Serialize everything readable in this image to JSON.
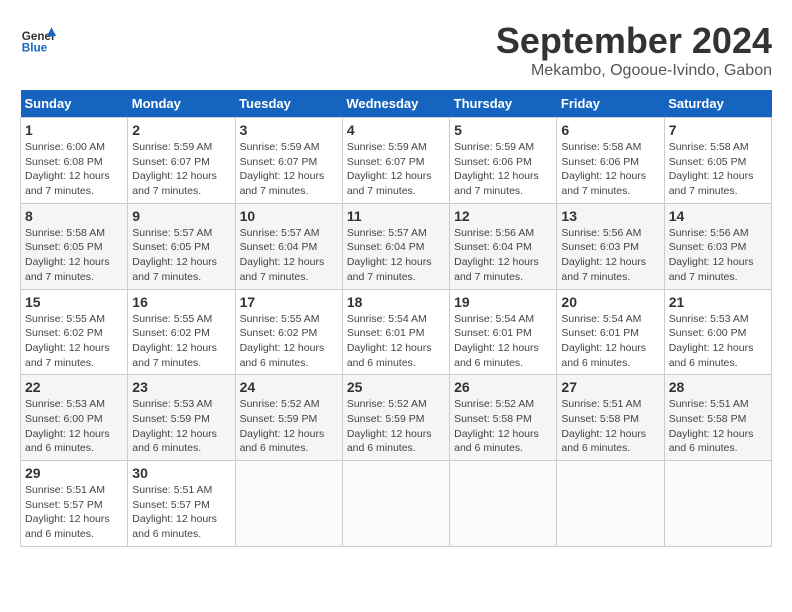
{
  "header": {
    "logo_line1": "General",
    "logo_line2": "Blue",
    "month": "September 2024",
    "location": "Mekambo, Ogooue-Ivindo, Gabon"
  },
  "weekdays": [
    "Sunday",
    "Monday",
    "Tuesday",
    "Wednesday",
    "Thursday",
    "Friday",
    "Saturday"
  ],
  "weeks": [
    [
      {
        "day": 1,
        "sunrise": "6:00 AM",
        "sunset": "6:08 PM",
        "daylight": "12 hours and 7 minutes."
      },
      {
        "day": 2,
        "sunrise": "5:59 AM",
        "sunset": "6:07 PM",
        "daylight": "12 hours and 7 minutes."
      },
      {
        "day": 3,
        "sunrise": "5:59 AM",
        "sunset": "6:07 PM",
        "daylight": "12 hours and 7 minutes."
      },
      {
        "day": 4,
        "sunrise": "5:59 AM",
        "sunset": "6:07 PM",
        "daylight": "12 hours and 7 minutes."
      },
      {
        "day": 5,
        "sunrise": "5:59 AM",
        "sunset": "6:06 PM",
        "daylight": "12 hours and 7 minutes."
      },
      {
        "day": 6,
        "sunrise": "5:58 AM",
        "sunset": "6:06 PM",
        "daylight": "12 hours and 7 minutes."
      },
      {
        "day": 7,
        "sunrise": "5:58 AM",
        "sunset": "6:05 PM",
        "daylight": "12 hours and 7 minutes."
      }
    ],
    [
      {
        "day": 8,
        "sunrise": "5:58 AM",
        "sunset": "6:05 PM",
        "daylight": "12 hours and 7 minutes."
      },
      {
        "day": 9,
        "sunrise": "5:57 AM",
        "sunset": "6:05 PM",
        "daylight": "12 hours and 7 minutes."
      },
      {
        "day": 10,
        "sunrise": "5:57 AM",
        "sunset": "6:04 PM",
        "daylight": "12 hours and 7 minutes."
      },
      {
        "day": 11,
        "sunrise": "5:57 AM",
        "sunset": "6:04 PM",
        "daylight": "12 hours and 7 minutes."
      },
      {
        "day": 12,
        "sunrise": "5:56 AM",
        "sunset": "6:04 PM",
        "daylight": "12 hours and 7 minutes."
      },
      {
        "day": 13,
        "sunrise": "5:56 AM",
        "sunset": "6:03 PM",
        "daylight": "12 hours and 7 minutes."
      },
      {
        "day": 14,
        "sunrise": "5:56 AM",
        "sunset": "6:03 PM",
        "daylight": "12 hours and 7 minutes."
      }
    ],
    [
      {
        "day": 15,
        "sunrise": "5:55 AM",
        "sunset": "6:02 PM",
        "daylight": "12 hours and 7 minutes."
      },
      {
        "day": 16,
        "sunrise": "5:55 AM",
        "sunset": "6:02 PM",
        "daylight": "12 hours and 7 minutes."
      },
      {
        "day": 17,
        "sunrise": "5:55 AM",
        "sunset": "6:02 PM",
        "daylight": "12 hours and 6 minutes."
      },
      {
        "day": 18,
        "sunrise": "5:54 AM",
        "sunset": "6:01 PM",
        "daylight": "12 hours and 6 minutes."
      },
      {
        "day": 19,
        "sunrise": "5:54 AM",
        "sunset": "6:01 PM",
        "daylight": "12 hours and 6 minutes."
      },
      {
        "day": 20,
        "sunrise": "5:54 AM",
        "sunset": "6:01 PM",
        "daylight": "12 hours and 6 minutes."
      },
      {
        "day": 21,
        "sunrise": "5:53 AM",
        "sunset": "6:00 PM",
        "daylight": "12 hours and 6 minutes."
      }
    ],
    [
      {
        "day": 22,
        "sunrise": "5:53 AM",
        "sunset": "6:00 PM",
        "daylight": "12 hours and 6 minutes."
      },
      {
        "day": 23,
        "sunrise": "5:53 AM",
        "sunset": "5:59 PM",
        "daylight": "12 hours and 6 minutes."
      },
      {
        "day": 24,
        "sunrise": "5:52 AM",
        "sunset": "5:59 PM",
        "daylight": "12 hours and 6 minutes."
      },
      {
        "day": 25,
        "sunrise": "5:52 AM",
        "sunset": "5:59 PM",
        "daylight": "12 hours and 6 minutes."
      },
      {
        "day": 26,
        "sunrise": "5:52 AM",
        "sunset": "5:58 PM",
        "daylight": "12 hours and 6 minutes."
      },
      {
        "day": 27,
        "sunrise": "5:51 AM",
        "sunset": "5:58 PM",
        "daylight": "12 hours and 6 minutes."
      },
      {
        "day": 28,
        "sunrise": "5:51 AM",
        "sunset": "5:58 PM",
        "daylight": "12 hours and 6 minutes."
      }
    ],
    [
      {
        "day": 29,
        "sunrise": "5:51 AM",
        "sunset": "5:57 PM",
        "daylight": "12 hours and 6 minutes."
      },
      {
        "day": 30,
        "sunrise": "5:51 AM",
        "sunset": "5:57 PM",
        "daylight": "12 hours and 6 minutes."
      },
      null,
      null,
      null,
      null,
      null
    ]
  ]
}
